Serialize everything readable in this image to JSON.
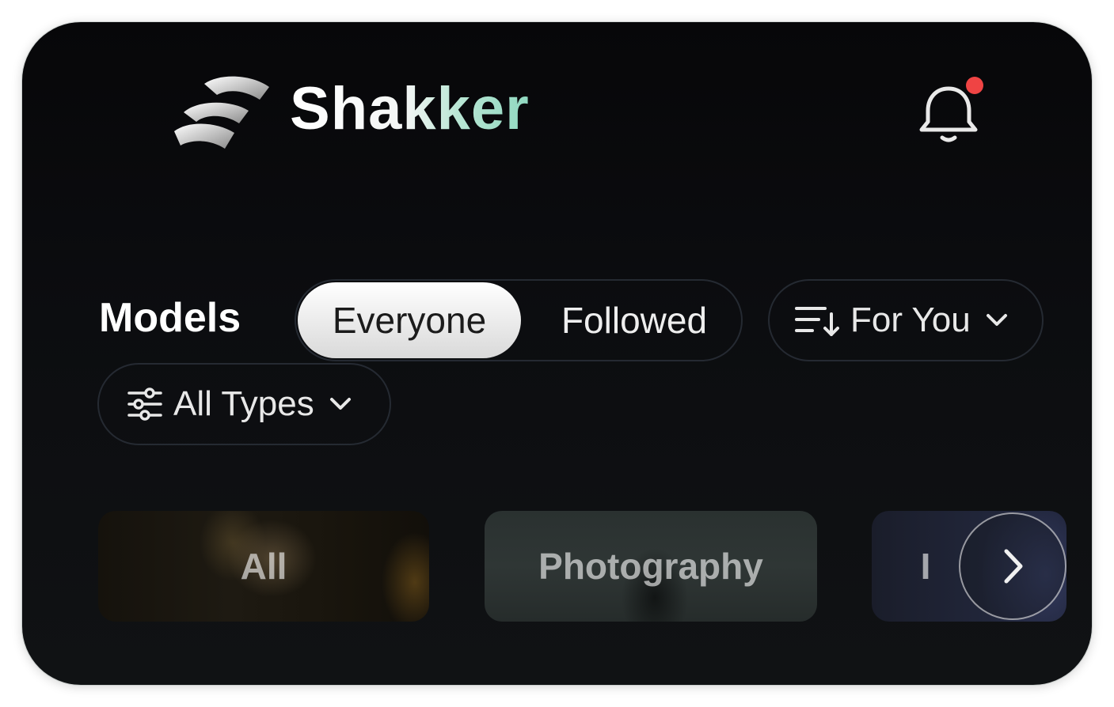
{
  "header": {
    "brand": "Shakker",
    "logo_icon": "shakker-logo-icon",
    "notification_icon": "bell-icon",
    "notification_dot_color": "#ef4444"
  },
  "section": {
    "title": "Models",
    "segment": {
      "options": [
        "Everyone",
        "Followed"
      ],
      "selected": "Everyone"
    },
    "sort": {
      "label": "For You",
      "icon": "sort-icon",
      "chevron": "chevron-down-icon"
    },
    "type_filter": {
      "label": "All Types",
      "icon": "sliders-icon",
      "chevron": "chevron-down-icon"
    }
  },
  "categories": [
    {
      "label": "All"
    },
    {
      "label": "Photography"
    },
    {
      "label": "I"
    }
  ],
  "carousel": {
    "next_icon": "chevron-right-icon"
  },
  "colors": {
    "background": "#0b0c0f",
    "active_segment": "#e6e6e6",
    "brand_accent": "#8fd8c0"
  }
}
